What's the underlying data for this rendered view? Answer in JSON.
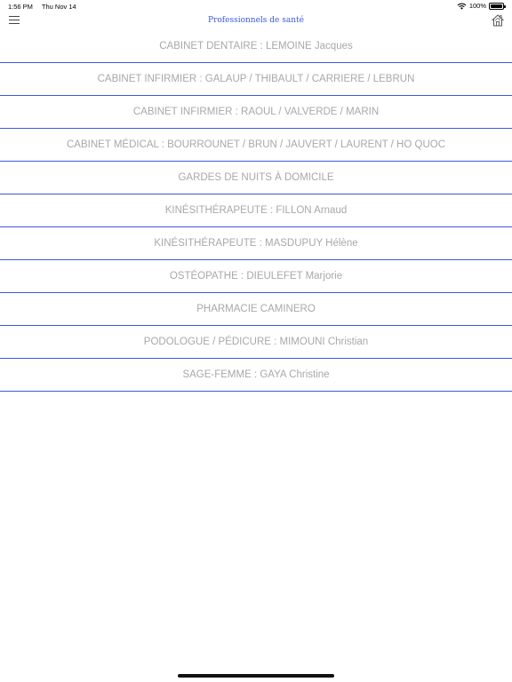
{
  "status_bar": {
    "time": "1:56 PM",
    "date": "Thu Nov 14",
    "battery": "100%",
    "wifi_icon": "wifi-icon",
    "battery_icon": "battery-icon"
  },
  "nav": {
    "title": "Professionnels de santé",
    "menu_icon": "hamburger-menu-icon",
    "home_icon": "home-icon",
    "accent_color": "#3a5ad8"
  },
  "list": {
    "items": [
      "CABINET DENTAIRE : LEMOINE Jacques",
      "CABINET INFIRMIER : GALAUP / THIBAULT / CARRIERE / LEBRUN",
      "CABINET INFIRMIER : RAOUL / VALVERDE / MARIN",
      "CABINET MÉDICAL : BOURROUNET / BRUN / JAUVERT / LAURENT / HO QUOC",
      "GARDES DE NUITS À DOMICILE",
      "KINÉSITHÉRAPEUTE : FILLON Arnaud",
      "KINÉSITHÉRAPEUTE : MASDUPUY Hélène",
      "OSTÉOPATHE : DIEULEFET Marjorie",
      "PHARMACIE CAMINERO",
      "PODOLOGUE / PÉDICURE : MIMOUNI Christian",
      "SAGE-FEMME : GAYA Christine"
    ],
    "text_color": "#a8a8a8",
    "divider_color": "#3a5ad8"
  }
}
